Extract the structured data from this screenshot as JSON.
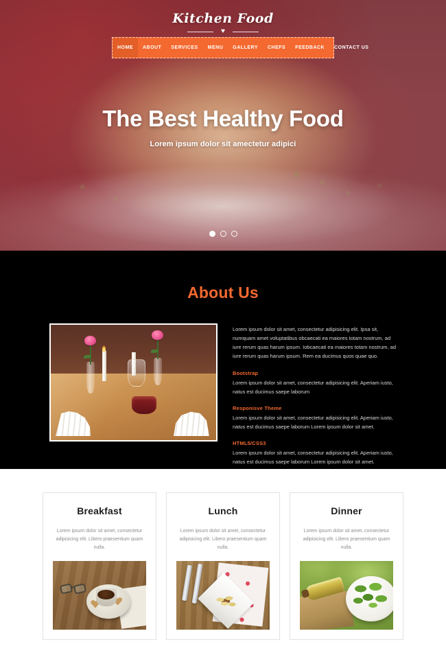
{
  "site": {
    "logo_text": "Kitchen Food",
    "logo_heart_icon": "heart-icon"
  },
  "nav": {
    "items": [
      {
        "label": "HOME",
        "active": true
      },
      {
        "label": "ABOUT",
        "active": false
      },
      {
        "label": "SERVICES",
        "active": false
      },
      {
        "label": "MENU",
        "active": false
      },
      {
        "label": "GALLERY",
        "active": false
      },
      {
        "label": "CHEFS",
        "active": false
      },
      {
        "label": "FEEDBACK",
        "active": false
      },
      {
        "label": "CONTACT US",
        "active": false
      }
    ]
  },
  "hero": {
    "title": "The Best Healthy Food",
    "subtitle": "Lorem ipsum dolor sit amectetur adipici",
    "slide_count": 3,
    "active_slide": 1,
    "image_alt": "blurred burger on white plate"
  },
  "about": {
    "title": "About Us",
    "image_alt": "restaurant table setting with roses wine glasses and candles",
    "intro": "Lorem ipsum dolor sit amet, consectetur adipisicing elit. Ipsa sit, numquam amet voluptatibus obcaecati ea maiores totam nostrum, ad iure rerum quas harum ipsum. Iobcaecati ea maiores totam nostrum, ad iure rerum quas harum ipsum. Rem ea ducimus quos quae quo.",
    "features": [
      {
        "heading": "Bootstrap",
        "text": "Lorem ipsum dolor sit amet, consectetur adipisicing elit. Aperiam iusto, natus est ducimus saepe laborum"
      },
      {
        "heading": "Responisve Theme",
        "text": "Lorem ipsum dolor sit amet, consectetur adipisicing elit. Aperiam iusto, natus est ducimus saepe laborum Lorem ipsum dolor sit amet."
      },
      {
        "heading": "HTML5/CSS3",
        "text": "Lorem ipsum dolor sit amet, consectetur adipisicing elit. Aperiam iusto, natus est ducimus saepe laborum Lorem ipsum dolor sit amet."
      }
    ]
  },
  "meals": {
    "cards": [
      {
        "title": "Breakfast",
        "description": "Lorem ipsum dolor sit amet, consectetur adipisicing elit. Libero praesentium quam nulla.",
        "image_alt": "coffee cup with heart shaped cookies and eyeglasses on wooden table"
      },
      {
        "title": "Lunch",
        "description": "Lorem ipsum dolor sit amet, consectetur adipisicing elit. Libero praesentium quam nulla.",
        "image_alt": "penne pasta on white square plate with fork and knife"
      },
      {
        "title": "Dinner",
        "description": "Lorem ipsum dolor sit amet, consectetur adipisicing elit. Libero praesentium quam nulla.",
        "image_alt": "fresh green salad bowl with olive oil bottle outdoors"
      }
    ]
  },
  "colors": {
    "accent_orange": "#f4692f",
    "nav_active": "#e35f27",
    "about_background": "#000000",
    "page_background": "#ffffff",
    "body_text": "#d8d8d8",
    "card_text": "#8c8c8c"
  }
}
